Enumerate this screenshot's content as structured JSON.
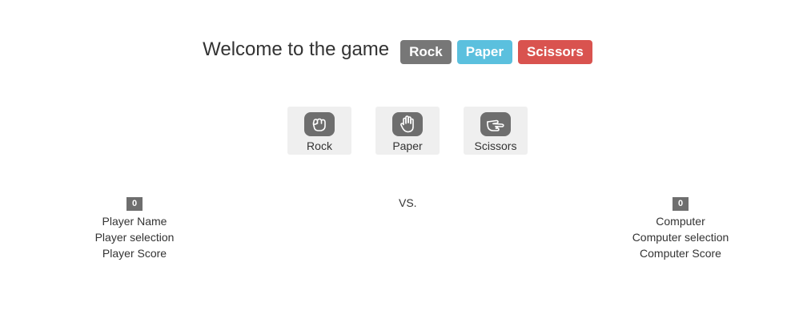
{
  "header": {
    "title": "Welcome to the game",
    "badges": [
      {
        "label": "Rock",
        "color": "#777777"
      },
      {
        "label": "Paper",
        "color": "#5bc0de"
      },
      {
        "label": "Scissors",
        "color": "#d9534f"
      }
    ]
  },
  "choices": [
    {
      "label": "Rock",
      "icon": "fist-icon"
    },
    {
      "label": "Paper",
      "icon": "open-hand-icon"
    },
    {
      "label": "Scissors",
      "icon": "scissors-hand-icon"
    }
  ],
  "vs_label": "VS.",
  "player": {
    "score": "0",
    "name": "Player Name",
    "selection": "Player selection",
    "score_label": "Player Score"
  },
  "computer": {
    "score": "0",
    "name": "Computer",
    "selection": "Computer selection",
    "score_label": "Computer Score"
  },
  "colors": {
    "neutral": "#777777",
    "info": "#5bc0de",
    "danger": "#d9534f",
    "icon_bg": "#6e6e6e",
    "button_bg": "#efefef"
  }
}
